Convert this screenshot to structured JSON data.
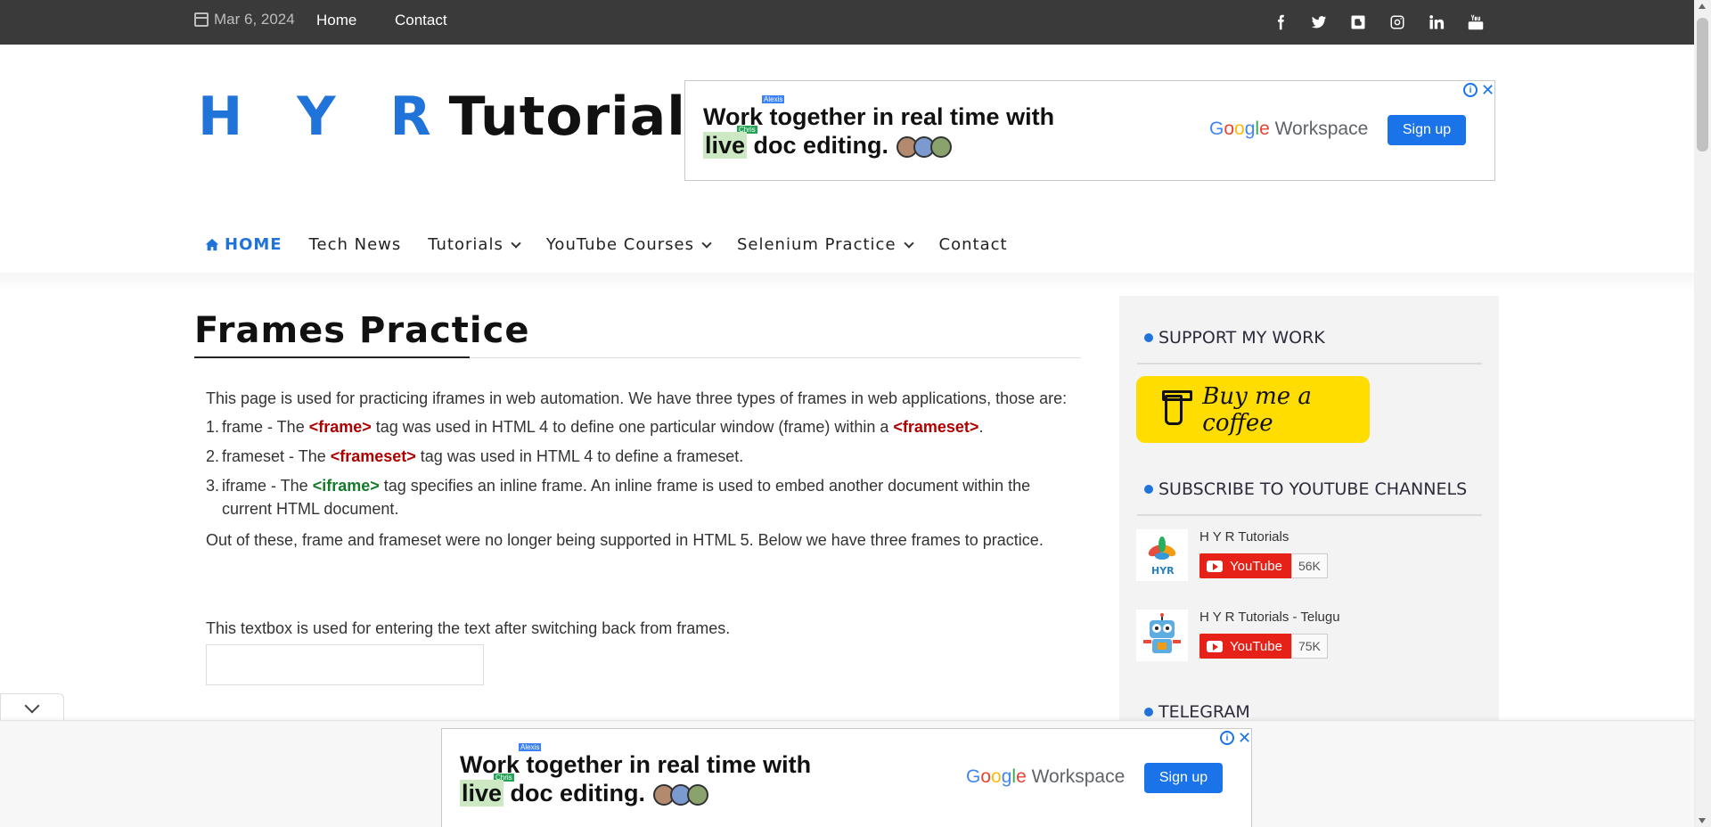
{
  "topbar": {
    "date": "Mar 6, 2024",
    "links": [
      "Home",
      "Contact"
    ],
    "social_icons": [
      "facebook-icon",
      "twitter-icon",
      "blogger-icon",
      "instagram-icon",
      "linkedin-icon",
      "youtube-icon"
    ]
  },
  "header": {
    "logo_part1": "H Y R",
    "logo_part2": "Tutorials"
  },
  "ad": {
    "headline_line1_a": "Work",
    "headline_line1_b": " together in real time with",
    "headline_line2_a": "live",
    "headline_line2_b": " doc editing.",
    "tag_alexis": "Alexis",
    "tag_chris": "Chris",
    "brand": "Workspace",
    "signup": "Sign up",
    "info": "i",
    "close": "✕"
  },
  "nav": {
    "items": [
      {
        "label": "HOME",
        "dropdown": false,
        "active": true
      },
      {
        "label": "Tech News",
        "dropdown": false
      },
      {
        "label": "Tutorials",
        "dropdown": true
      },
      {
        "label": "YouTube Courses",
        "dropdown": true
      },
      {
        "label": "Selenium Practice",
        "dropdown": true
      },
      {
        "label": "Contact",
        "dropdown": false
      }
    ]
  },
  "main": {
    "title": "Frames Practice",
    "intro": "This page is used for practicing iframes in web automation. We have three types of frames in web applications, those are:",
    "list": [
      {
        "num": "1.",
        "pre": "frame - The ",
        "tag": "<frame>",
        "mid": " tag was used in HTML 4 to define one particular window (frame) within a ",
        "tag2": "<frameset>",
        "post": "."
      },
      {
        "num": "2.",
        "pre": "frameset - The ",
        "tag": "<frameset>",
        "post": " tag was used in HTML 4 to define a frameset."
      },
      {
        "num": "3.",
        "pre": "iframe - The ",
        "tag": "<iframe>",
        "post": " tag specifies an inline frame. An inline frame is used to embed another document within the current HTML document."
      }
    ],
    "after": "Out of these, frame and frameset were no longer being supported in HTML 5. Below we have three frames to practice.",
    "textbox_label": "This textbox is used for entering the text after switching back from frames.",
    "textbox_value": ""
  },
  "sidebar": {
    "support_heading": "SUPPORT MY WORK",
    "bmc_label": "Buy me a coffee",
    "subscribe_heading": "SUBSCRIBE TO YOUTUBE CHANNELS",
    "channels": [
      {
        "name": "H Y R Tutorials",
        "button": "YouTube",
        "count": "56K"
      },
      {
        "name": "H Y R Tutorials - Telugu",
        "button": "YouTube",
        "count": "75K"
      }
    ],
    "telegram_heading": "TELEGRAM"
  }
}
